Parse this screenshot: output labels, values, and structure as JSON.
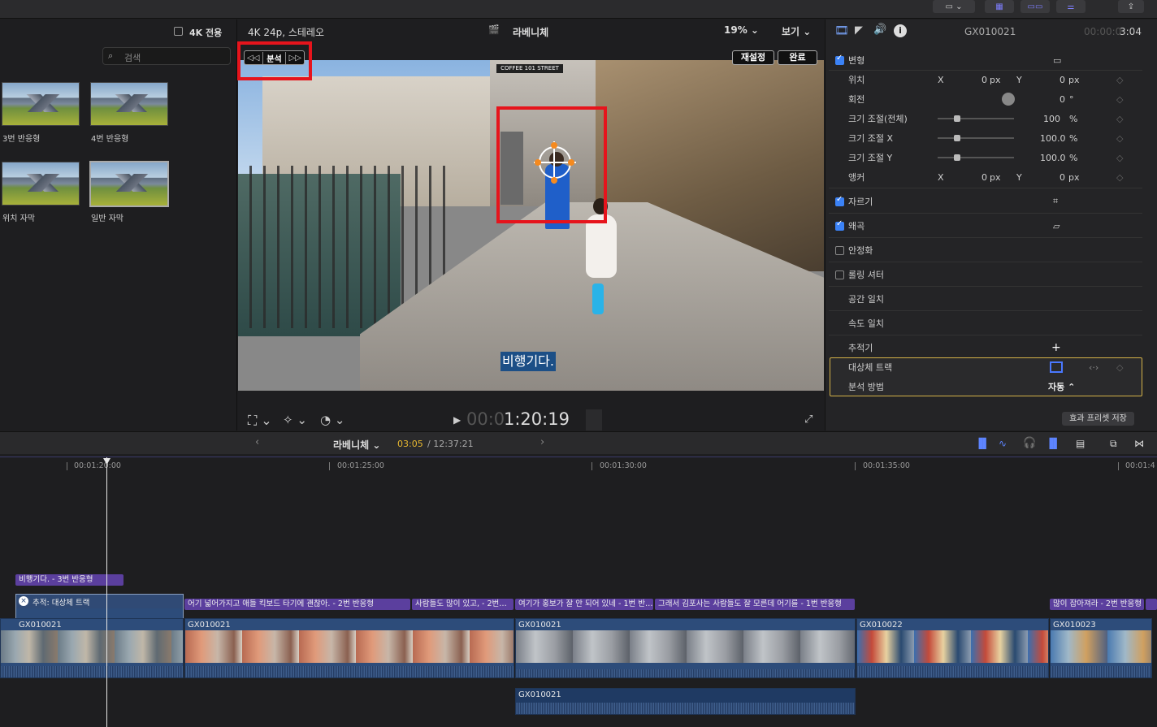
{
  "browser": {
    "uhd_only": "4K 전용",
    "search_placeholder": "검색",
    "items": [
      {
        "label": "3번 반응형"
      },
      {
        "label": "4번 반응형"
      },
      {
        "label": "위치 자막"
      },
      {
        "label": "일반 자막"
      }
    ]
  },
  "viewer": {
    "format": "4K 24p, 스테레오",
    "project": "라베니체",
    "zoom": "19%",
    "view": "보기",
    "analyze": "분석",
    "reset": "재설정",
    "done": "완료",
    "caption": "비행기다.",
    "timecode_dim": "00:0",
    "timecode": "1:20:19",
    "sign": "COFFEE 101 STREET"
  },
  "inspector": {
    "clip_name": "GX010021",
    "duration_dim": "00:00:0",
    "duration": "3:04",
    "transform": "변형",
    "position": "위치",
    "x": "X",
    "y": "Y",
    "zero": "0",
    "px": "px",
    "rotation": "회전",
    "rotation_val": "0",
    "deg": "°",
    "scale_all": "크기 조절(전체)",
    "scale_all_val": "100",
    "scale_x": "크기 조절 X",
    "scale_x_val": "100.0",
    "scale_y": "크기 조절 Y",
    "scale_y_val": "100.0",
    "pct": "%",
    "anchor": "앵커",
    "crop": "자르기",
    "distort": "왜곡",
    "stabilize": "안정화",
    "rolling": "롤링 셔터",
    "spatial": "공간 일치",
    "speed": "속도 일치",
    "tracker": "추적기",
    "plus": "+",
    "subject_track": "대상체 트랙",
    "analysis_method": "분석 방법",
    "analysis_val": "자동 ⌃",
    "save_preset": "효과 프리셋 저장"
  },
  "timeline": {
    "project": "라베니체",
    "current": "03:05",
    "total": "/ 12:37:21",
    "ticks": [
      "00:01:20:00",
      "00:01:25:00",
      "00:01:30:00",
      "00:01:35:00",
      "00:01:4"
    ],
    "titles": [
      "비행기다. - 3번 반응형",
      "어기 넓어가지고 애들 킥보드 타기에 괜찮아. - 2번 반응형",
      "사람들도 많이 있고, - 2번…",
      "여기가 홍보가 잘 안 되어 있네 - 1번 반…",
      "그래서 김포사는 사람들도 잘 모른데 어기를 - 1번 반응형",
      "많이 잡아져라 - 2번 반응형"
    ],
    "tracker_clip": "추적: 대상체 트랙",
    "clips": [
      "GX010021",
      "GX010021",
      "GX010021",
      "GX010022",
      "GX010023"
    ],
    "audio_clip": "GX010021"
  }
}
